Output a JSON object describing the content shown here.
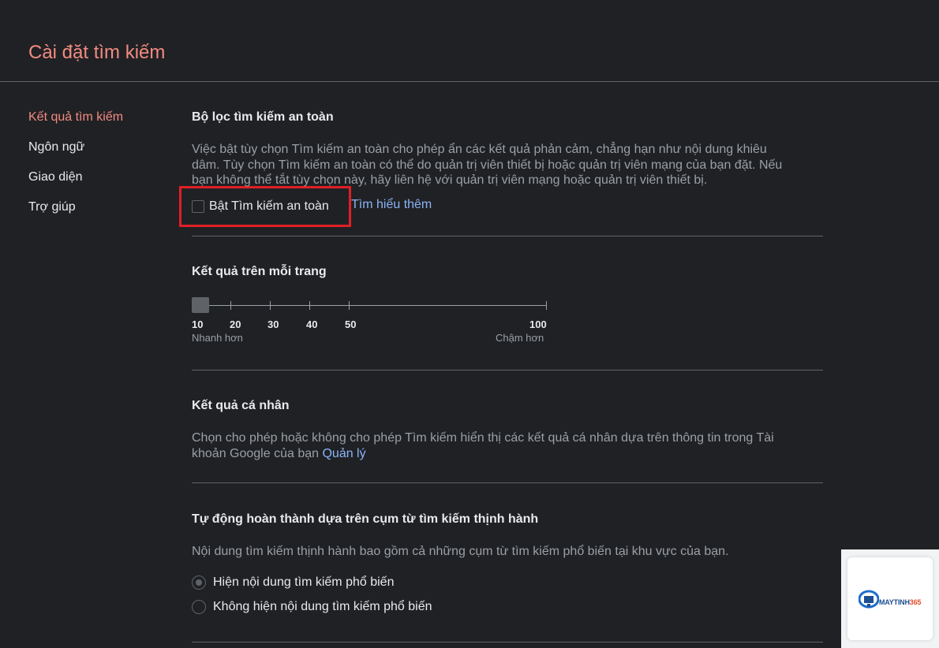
{
  "header": {
    "title": "Cài đặt tìm kiếm"
  },
  "sidebar": {
    "items": [
      {
        "label": "Kết quả tìm kiếm",
        "active": true
      },
      {
        "label": "Ngôn ngữ"
      },
      {
        "label": "Giao diện"
      },
      {
        "label": "Trợ giúp"
      }
    ]
  },
  "safe_search": {
    "title": "Bộ lọc tìm kiếm an toàn",
    "description": "Việc bật tùy chọn Tìm kiếm an toàn cho phép ẩn các kết quả phản cảm, chẳng hạn như nội dung khiêu dâm. Tùy chọn Tìm kiếm an toàn có thể do quản trị viên thiết bị hoặc quản trị viên mạng của bạn đặt. Nếu bạn không thể tắt tùy chọn này, hãy liên hệ với quản trị viên mạng hoặc quản trị viên thiết bị.",
    "checkbox_label": "Bật Tìm kiếm an toàn",
    "checked": false,
    "learn_more": "Tìm hiểu thêm"
  },
  "results_per_page": {
    "title": "Kết quả trên mỗi trang",
    "ticks": [
      "10",
      "20",
      "30",
      "40",
      "50",
      "100"
    ],
    "selected": "10",
    "faster_label": "Nhanh hơn",
    "slower_label": "Chậm hơn"
  },
  "personal_results": {
    "title": "Kết quả cá nhân",
    "description": "Chọn cho phép hoặc không cho phép Tìm kiếm hiển thị các kết quả cá nhân dựa trên thông tin trong Tài khoản Google của bạn",
    "manage_link": "Quản lý"
  },
  "trending": {
    "title": "Tự động hoàn thành dựa trên cụm từ tìm kiếm thịnh hành",
    "description": "Nội dung tìm kiếm thịnh hành bao gồm cả những cụm từ tìm kiếm phổ biến tại khu vực của bạn.",
    "options": [
      {
        "label": "Hiện nội dung tìm kiếm phổ biến",
        "selected": true
      },
      {
        "label": "Không hiện nội dung tìm kiếm phổ biến",
        "selected": false
      }
    ]
  },
  "watermark": {
    "brand": "MAYTINH",
    "brand_number": "365"
  },
  "colors": {
    "background": "#202124",
    "accent": "#f28b82",
    "link": "#8ab4f8",
    "highlight": "#e01f26"
  }
}
